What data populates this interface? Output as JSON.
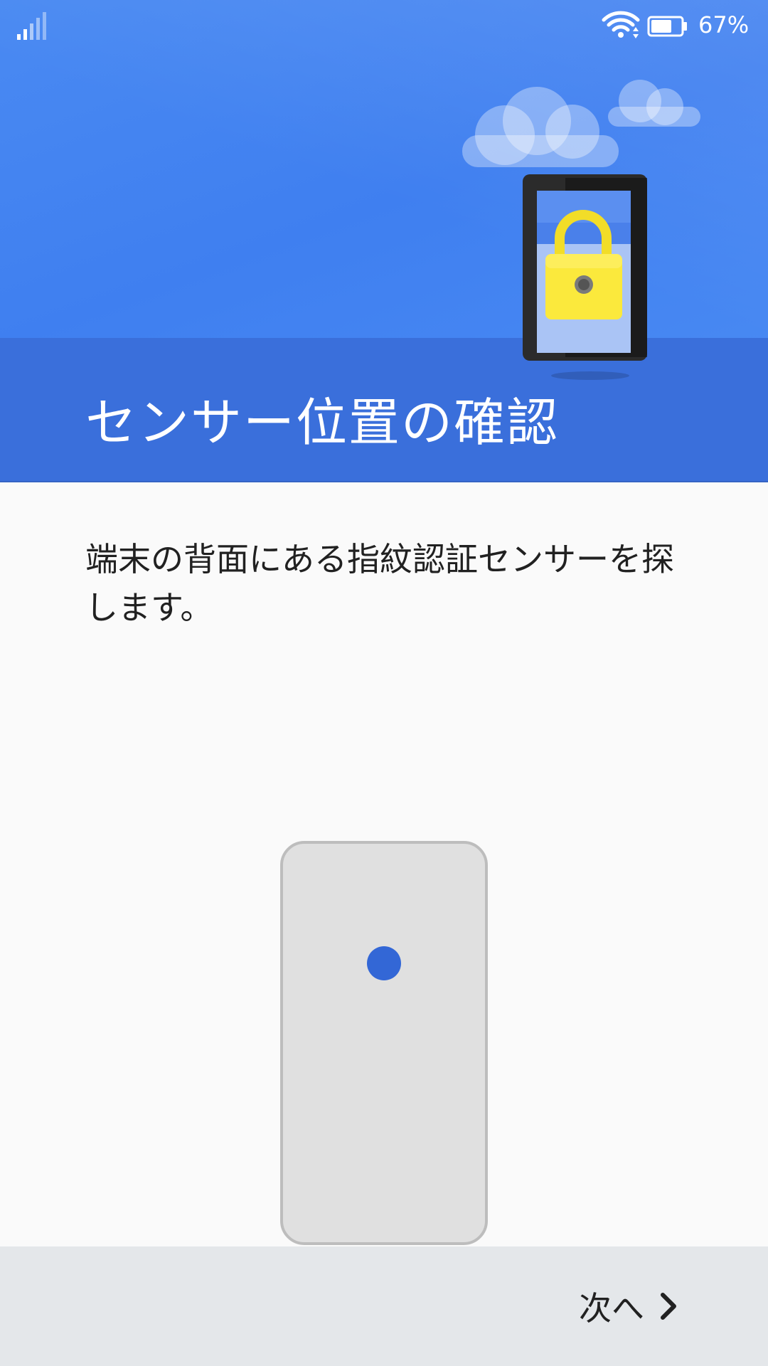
{
  "status_bar": {
    "battery_percent": "67%",
    "icons": [
      "signal-icon",
      "wifi-icon",
      "battery-icon"
    ]
  },
  "header": {
    "title": "センサー位置の確認",
    "illustration": "tablet-with-padlock"
  },
  "main": {
    "description": "端末の背面にある指紋認証センサーを探します。"
  },
  "footer": {
    "next_label": "次へ",
    "next_icon": "chevron-right-icon"
  },
  "colors": {
    "header_blue": "#4a8af2",
    "header_band": "#3a6fdb",
    "sensor_dot": "#3367d6",
    "footer_bg": "#e4e7ea"
  }
}
